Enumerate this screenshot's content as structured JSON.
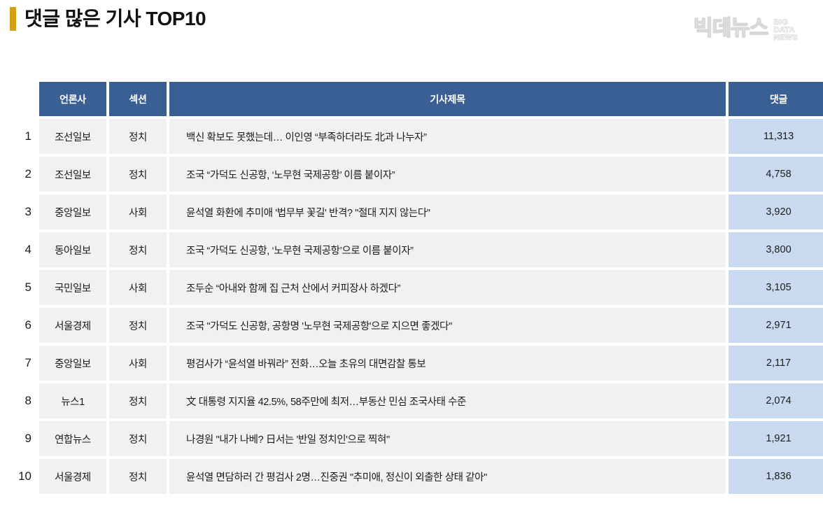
{
  "header": {
    "title": "댓글 많은 기사 TOP10",
    "accent_color": "#d2a017"
  },
  "logo": {
    "brand_ko": "빅데뉴스",
    "sub_line1": "BIG",
    "sub_line2": "DATA",
    "sub_line3": "NEWS"
  },
  "table": {
    "header_bg": "#3a5f94",
    "row_bg": "#f1f1f1",
    "count_bg": "#c9d9f0",
    "columns": [
      {
        "key": "rank",
        "label": ""
      },
      {
        "key": "press",
        "label": "언론사"
      },
      {
        "key": "section",
        "label": "섹션"
      },
      {
        "key": "title",
        "label": "기사제목"
      },
      {
        "key": "count",
        "label": "댓글"
      }
    ],
    "rows": [
      {
        "rank": "1",
        "press": "조선일보",
        "section": "정치",
        "title": "백신 확보도 못했는데… 이인영 “부족하더라도 北과 나누자”",
        "count": "11,313"
      },
      {
        "rank": "2",
        "press": "조선일보",
        "section": "정치",
        "title": "조국 “가덕도 신공항, ‘노무현 국제공항’ 이름 붙이자”",
        "count": "4,758"
      },
      {
        "rank": "3",
        "press": "중앙일보",
        "section": "사회",
        "title": "윤석열 화환에 추미애 '법무부 꽃길' 반격? \"절대 지지 않는다\"",
        "count": "3,920"
      },
      {
        "rank": "4",
        "press": "동아일보",
        "section": "정치",
        "title": "조국 “가덕도 신공항, ‘노무현 국제공항’으로 이름 붙이자”",
        "count": "3,800"
      },
      {
        "rank": "5",
        "press": "국민일보",
        "section": "사회",
        "title": "조두순 “아내와 함께 집 근처 산에서 커피장사 하겠다”",
        "count": "3,105"
      },
      {
        "rank": "6",
        "press": "서울경제",
        "section": "정치",
        "title": "조국 \"가덕도 신공항, 공항명 '노무현 국제공항'으로 지으면 좋겠다\"",
        "count": "2,971"
      },
      {
        "rank": "7",
        "press": "중앙일보",
        "section": "사회",
        "title": "평검사가 “윤석열 바꿔라” 전화…오늘 초유의 대면감찰 통보",
        "count": "2,117"
      },
      {
        "rank": "8",
        "press": "뉴스1",
        "section": "정치",
        "title": "文 대통령 지지율 42.5%, 58주만에 최저…부동산 민심 조국사태 수준",
        "count": "2,074"
      },
      {
        "rank": "9",
        "press": "연합뉴스",
        "section": "정치",
        "title": "나경원 \"내가 나베? 日서는 '반일 정치인'으로 찍혀\"",
        "count": "1,921"
      },
      {
        "rank": "10",
        "press": "서울경제",
        "section": "정치",
        "title": "윤석열 면담하러 간 평검사 2명…진중권 \"추미애, 정신이 외출한 상태 같아\"",
        "count": "1,836"
      }
    ]
  }
}
